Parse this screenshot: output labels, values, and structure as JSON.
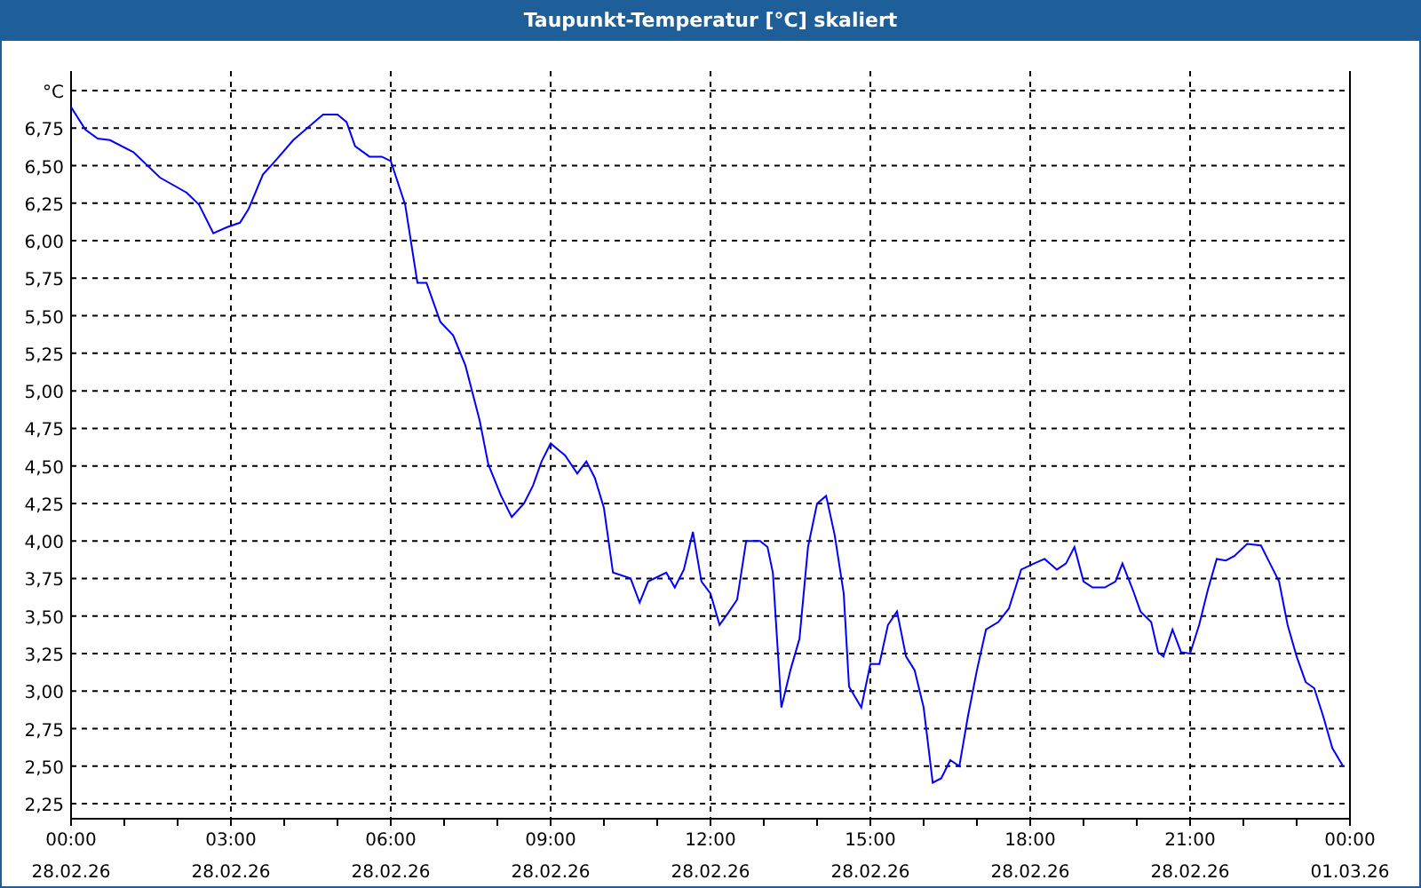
{
  "window": {
    "title": "Taupunkt-Temperatur [°C] skaliert"
  },
  "chart": {
    "chart_data": {
      "type": "line",
      "grid": true,
      "xlim": [
        0,
        24
      ],
      "ylim": [
        2.15,
        7.13
      ],
      "xticks": [
        {
          "value": 0,
          "label": "00:00"
        },
        {
          "value": 3,
          "label": "03:00"
        },
        {
          "value": 6,
          "label": "06:00"
        },
        {
          "value": 9,
          "label": "09:00"
        },
        {
          "value": 12,
          "label": "12:00"
        },
        {
          "value": 15,
          "label": "15:00"
        },
        {
          "value": 18,
          "label": "18:00"
        },
        {
          "value": 21,
          "label": "21:00"
        },
        {
          "value": 24,
          "label": "00:00"
        }
      ],
      "yticks": [
        {
          "value": 2.25,
          "label": "2,25"
        },
        {
          "value": 2.5,
          "label": "2,50"
        },
        {
          "value": 2.75,
          "label": "2,75"
        },
        {
          "value": 3,
          "label": "3,00"
        },
        {
          "value": 3.25,
          "label": "3,25"
        },
        {
          "value": 3.5,
          "label": "3,50"
        },
        {
          "value": 3.75,
          "label": "3,75"
        },
        {
          "value": 4,
          "label": "4,00"
        },
        {
          "value": 4.25,
          "label": "4,25"
        },
        {
          "value": 4.5,
          "label": "4,50"
        },
        {
          "value": 4.75,
          "label": "4,75"
        },
        {
          "value": 5,
          "label": "5,00"
        },
        {
          "value": 5.25,
          "label": "5,25"
        },
        {
          "value": 5.5,
          "label": "5,50"
        },
        {
          "value": 5.75,
          "label": "5,75"
        },
        {
          "value": 6,
          "label": "6,00"
        },
        {
          "value": 6.25,
          "label": "6,25"
        },
        {
          "value": 6.5,
          "label": "6,50"
        },
        {
          "value": 6.75,
          "label": "6,75"
        },
        {
          "value": 7,
          "label": "°C"
        }
      ],
      "x": [
        0,
        0.27,
        0.5,
        0.73,
        1.17,
        1.67,
        2.17,
        2.4,
        2.67,
        2.93,
        3.17,
        3.33,
        3.6,
        3.83,
        4.17,
        4.5,
        4.73,
        5,
        5.17,
        5.33,
        5.6,
        5.83,
        6,
        6.27,
        6.5,
        6.67,
        6.93,
        7.17,
        7.4,
        7.67,
        7.83,
        8.07,
        8.27,
        8.5,
        8.67,
        8.83,
        9,
        9.27,
        9.5,
        9.67,
        9.83,
        10,
        10.17,
        10.5,
        10.67,
        10.83,
        11.17,
        11.33,
        11.5,
        11.67,
        11.83,
        12,
        12.17,
        12.33,
        12.5,
        12.67,
        12.93,
        13.07,
        13.17,
        13.33,
        13.5,
        13.67,
        13.83,
        14,
        14.17,
        14.33,
        14.5,
        14.6,
        14.83,
        15,
        15.17,
        15.33,
        15.5,
        15.67,
        15.83,
        16,
        16.17,
        16.33,
        16.5,
        16.67,
        16.83,
        17,
        17.17,
        17.4,
        17.6,
        17.83,
        18.07,
        18.27,
        18.5,
        18.67,
        18.83,
        19,
        19.17,
        19.4,
        19.6,
        19.73,
        19.93,
        20.07,
        20.27,
        20.4,
        20.5,
        20.67,
        20.83,
        21,
        21.17,
        21.33,
        21.5,
        21.67,
        21.83,
        22.07,
        22.33,
        22.5,
        22.67,
        22.83,
        23,
        23.17,
        23.33,
        23.5,
        23.67,
        23.87
      ],
      "series": [
        {
          "color": "#0000ff",
          "values": [
            6.89,
            6.74,
            6.68,
            6.67,
            6.59,
            6.42,
            6.32,
            6.24,
            6.05,
            6.09,
            6.12,
            6.21,
            6.44,
            6.53,
            6.67,
            6.77,
            6.84,
            6.84,
            6.79,
            6.63,
            6.56,
            6.56,
            6.53,
            6.24,
            5.72,
            5.72,
            5.46,
            5.37,
            5.17,
            4.8,
            4.51,
            4.3,
            4.16,
            4.25,
            4.37,
            4.53,
            4.65,
            4.57,
            4.45,
            4.53,
            4.42,
            4.22,
            3.79,
            3.75,
            3.59,
            3.73,
            3.79,
            3.69,
            3.81,
            4.06,
            3.73,
            3.65,
            3.44,
            3.52,
            3.61,
            4,
            4,
            3.96,
            3.79,
            2.89,
            3.14,
            3.35,
            3.96,
            4.25,
            4.3,
            4.04,
            3.65,
            3.03,
            2.89,
            3.18,
            3.18,
            3.44,
            3.53,
            3.23,
            3.14,
            2.89,
            2.39,
            2.42,
            2.54,
            2.5,
            2.83,
            3.14,
            3.41,
            3.46,
            3.55,
            3.81,
            3.85,
            3.88,
            3.81,
            3.85,
            3.96,
            3.73,
            3.69,
            3.69,
            3.73,
            3.85,
            3.67,
            3.53,
            3.46,
            3.26,
            3.23,
            3.41,
            3.26,
            3.25,
            3.44,
            3.67,
            3.88,
            3.87,
            3.9,
            3.98,
            3.97,
            3.85,
            3.73,
            3.44,
            3.23,
            3.06,
            3.02,
            2.83,
            2.62,
            2.5
          ]
        }
      ]
    },
    "x_tick_dates": [
      "28.02.26",
      "28.02.26",
      "28.02.26",
      "28.02.26",
      "28.02.26",
      "28.02.26",
      "28.02.26",
      "28.02.26",
      "01.03.26"
    ]
  }
}
